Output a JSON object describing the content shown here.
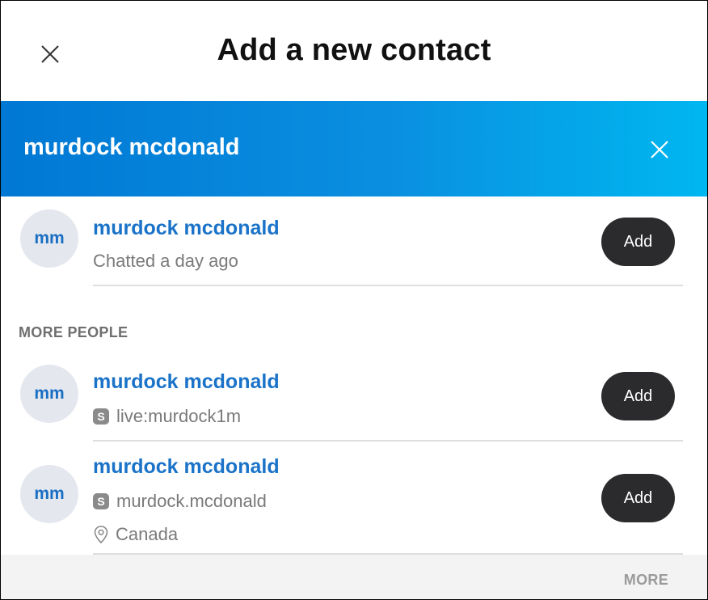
{
  "header": {
    "title": "Add a new contact",
    "close_icon": "close-icon"
  },
  "search": {
    "query": "murdock mcdonald",
    "clear_icon": "close-icon",
    "gradient_start": "#0078d4",
    "gradient_end": "#00b7f0"
  },
  "recent": {
    "avatar": "mm",
    "name": "murdock mcdonald",
    "status": "Chatted a day ago",
    "add_label": "Add"
  },
  "more_people": {
    "label": "MORE PEOPLE",
    "items": [
      {
        "avatar": "mm",
        "name": "murdock mcdonald",
        "skype_badge": "S",
        "skype_id": "live:murdock1m",
        "add_label": "Add"
      },
      {
        "avatar": "mm",
        "name": "murdock mcdonald",
        "skype_badge": "S",
        "skype_id": "murdock.mcdonald",
        "location": "Canada",
        "add_label": "Add"
      }
    ]
  },
  "footer": {
    "more_label": "MORE"
  },
  "colors": {
    "name_blue": "#1a73c8",
    "button_dark": "#2b2b2e",
    "avatar_bg": "#e4e7ee"
  }
}
